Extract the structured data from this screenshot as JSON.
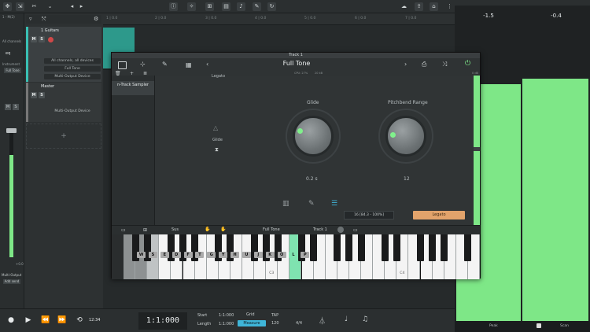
{
  "top_toolbar": {
    "ruler_labels": [
      "1 | 0.0",
      "2 | 0.0",
      "3 | 0.0",
      "4 | 0.0",
      "5 | 0.0",
      "6 | 0.0",
      "7 | 0.0"
    ]
  },
  "left_strip": {
    "label_top": "1 - M(2)",
    "label_all": "All channels",
    "eq_label": "eq",
    "instrument_label": "Instrument",
    "full_tone_label": "Full Tone",
    "m_label": "M",
    "s_label": "S",
    "multi_output": "Multi-Output",
    "add_send": "Add send",
    "level_readout": "+0.0"
  },
  "tracks": {
    "guitars": {
      "name": "1 Guitars",
      "m": "M",
      "s": "S",
      "input": "All channels, all devices",
      "instrument": "Full Tone",
      "output": "Multi-Output Device"
    },
    "master": {
      "name": "Master",
      "m": "M",
      "s": "S",
      "output": "Multi-Output Device"
    },
    "add_track": "+"
  },
  "plugin": {
    "window_title": "Track 1",
    "preset_name": "Full Tone",
    "cpu_label": "CPU: 27%",
    "latency_label": "20 kB",
    "db_label": "0 dB",
    "sampler_name": "n-Track Sampler",
    "legato_header": "Legato",
    "glide_left_label": "Glide",
    "glide_knob_label": "Glide",
    "glide_value": "0.2 s",
    "pitchbend_label": "Pitchbend Range",
    "pitchbend_value": "12",
    "range_field": "16  [84.3 - 100%]",
    "legato_button": "Legato",
    "sus_label": "Sus",
    "kb_preset": "Full Tone",
    "kb_track": "Track 1",
    "key_letters": [
      "W",
      "S",
      "E",
      "D",
      "F",
      "T",
      "G",
      "Y",
      "H",
      "U",
      "J",
      "K",
      "O",
      "L",
      "P"
    ],
    "key_c_labels": [
      "C3",
      "C4"
    ],
    "colors": {
      "accent_green": "#80f08c",
      "teal": "#39c0b4",
      "legato_orange": "#e2a36b",
      "pressed_key": "#7fe3b0"
    }
  },
  "right_panel": {
    "meter_left_value": "-1.5",
    "meter_right_value": "-0.4",
    "meter_levels": [
      0.86,
      0.88
    ],
    "peak_label": "Peak",
    "scan_label": "Scan"
  },
  "transport": {
    "position": "1:1:000",
    "start_label": "Start",
    "start_value": "1:1:000",
    "length_label": "Length",
    "length_value": "1:1:000",
    "grid_label": "Grid",
    "grid_value": "Measure",
    "bpm_value": "120",
    "bpm_label": "TAP",
    "signature": "4/4",
    "meter_small": "12:34"
  }
}
